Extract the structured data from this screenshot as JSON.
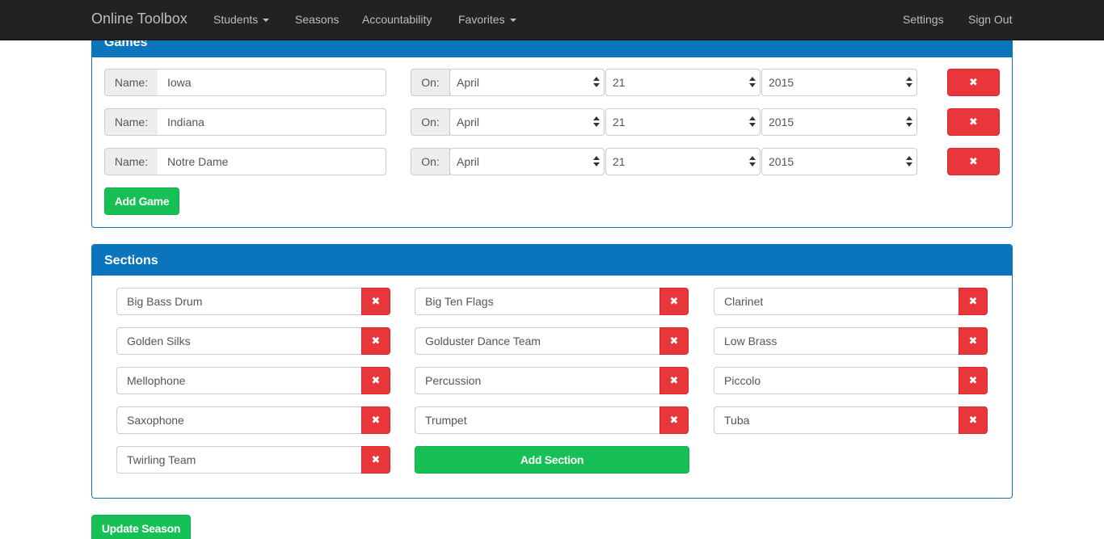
{
  "navbar": {
    "brand": "Online Toolbox",
    "items": [
      {
        "label": "Students",
        "dropdown": true
      },
      {
        "label": "Seasons",
        "dropdown": false
      },
      {
        "label": "Accountability",
        "dropdown": false
      },
      {
        "label": "Favorites",
        "dropdown": true
      }
    ],
    "right_items": [
      {
        "label": "Settings"
      },
      {
        "label": "Sign Out"
      }
    ]
  },
  "games": {
    "title": "Games",
    "name_label": "Name:",
    "on_label": "On:",
    "rows": [
      {
        "name": "Iowa",
        "month": "April",
        "day": "21",
        "year": "2015"
      },
      {
        "name": "Indiana",
        "month": "April",
        "day": "21",
        "year": "2015"
      },
      {
        "name": "Notre Dame",
        "month": "April",
        "day": "21",
        "year": "2015"
      }
    ],
    "delete_icon": "✖",
    "add_label": "Add Game"
  },
  "sections": {
    "title": "Sections",
    "items": [
      "Big Bass Drum",
      "Big Ten Flags",
      "Clarinet",
      "Golden Silks",
      "Goldust​er Dance Team",
      "Low Brass",
      "Mellophone",
      "Percussion",
      "Piccolo",
      "Saxophone",
      "Trumpet",
      "Tuba",
      "Twirling Team"
    ],
    "delete_icon": "✖",
    "add_label": "Add Section"
  },
  "update_label": "Update Season",
  "colors": {
    "navbar_bg": "#222222",
    "panel_blue": "#0a75bc",
    "danger_red": "#e8363b",
    "success_green": "#17c054"
  }
}
